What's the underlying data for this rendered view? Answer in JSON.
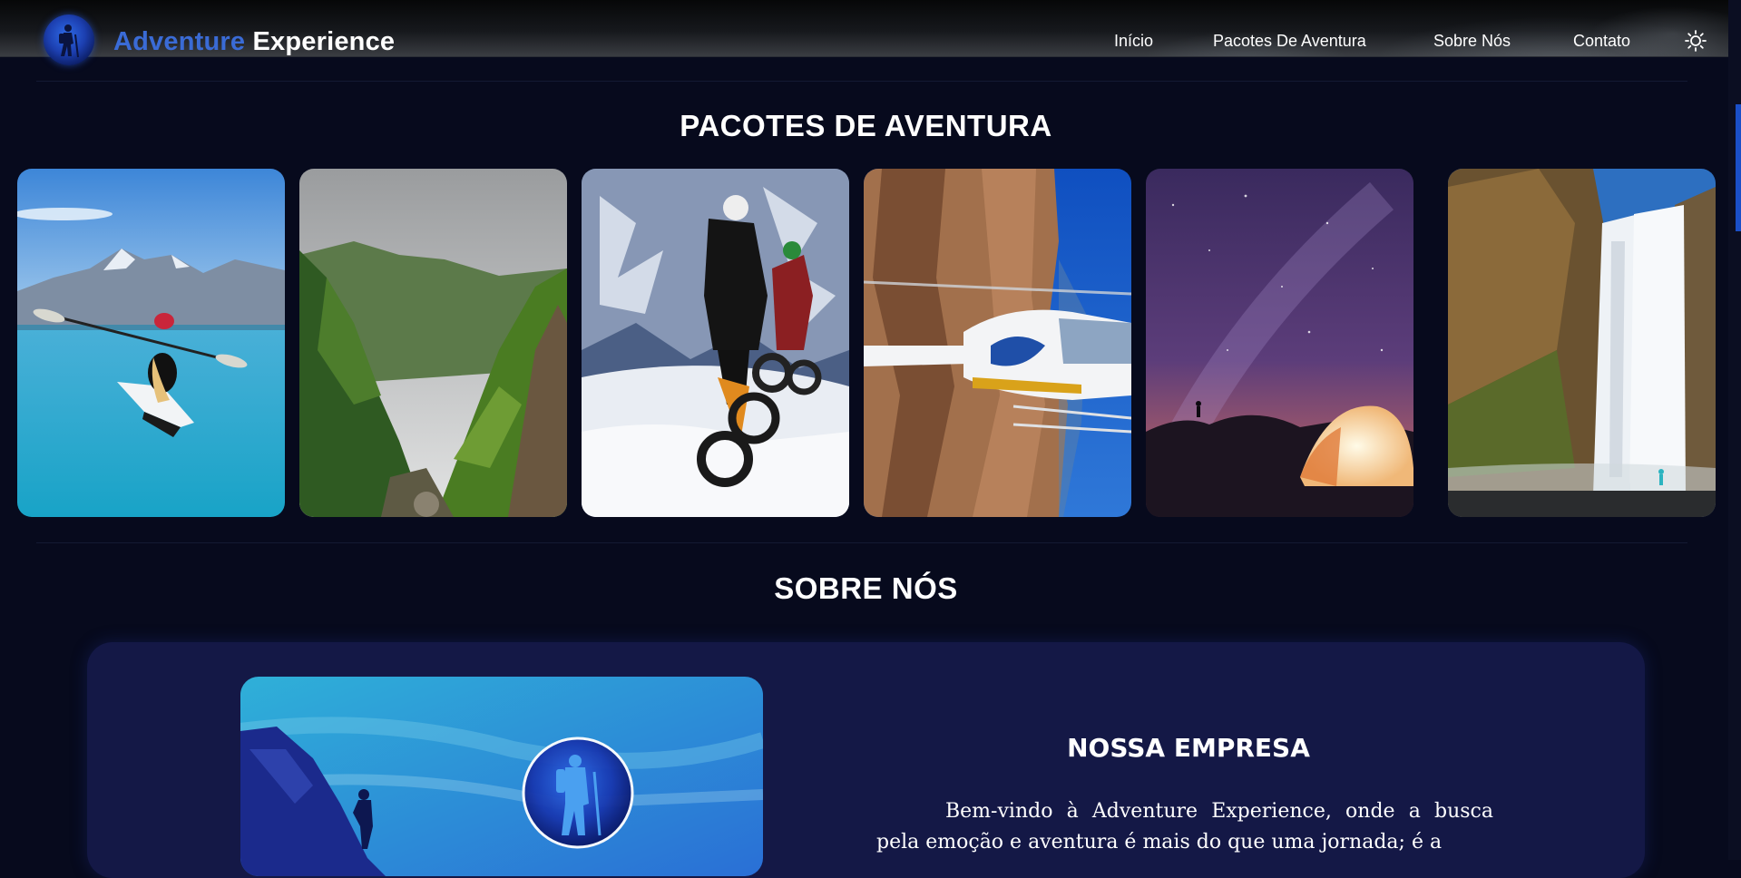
{
  "brand": {
    "part1": "Adventure",
    "part2": "Experience"
  },
  "nav": [
    {
      "label": "Início"
    },
    {
      "label": "Pacotes De Aventura"
    },
    {
      "label": "Sobre Nós"
    },
    {
      "label": "Contato"
    }
  ],
  "theme_toggle_icon": "sun-icon",
  "packages": {
    "title": "PACOTES DE AVENTURA",
    "items": [
      {
        "icon": "kayak-photo"
      },
      {
        "icon": "green-cliffs-photo"
      },
      {
        "icon": "snow-biking-photo"
      },
      {
        "icon": "helicopter-photo"
      },
      {
        "icon": "night-camping-photo"
      },
      {
        "icon": "waterfall-photo"
      }
    ]
  },
  "about": {
    "title": "SOBRE NÓS",
    "heading": "NOSSA EMPRESA",
    "text": "Bem-vindo à Adventure Experience, onde a busca pela emoção e aventura é mais do que uma jornada; é a"
  },
  "colors": {
    "background": "#070a1d",
    "accent": "#3a6bd6",
    "panel": "#141846"
  }
}
